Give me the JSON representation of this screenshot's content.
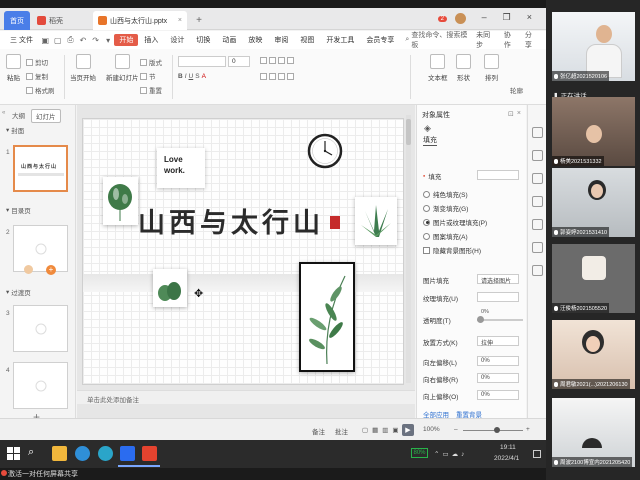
{
  "tabs": {
    "home": "首页",
    "store": "稻壳",
    "document": "山西与太行山.pptx",
    "add": "+"
  },
  "menu": {
    "file": "三 文件",
    "items": [
      "开始",
      "插入",
      "设计",
      "切换",
      "动画",
      "放映",
      "审阅",
      "视图",
      "开发工具",
      "会员专享"
    ],
    "search": "查找命令、搜索模板",
    "right": [
      "未同步",
      "协作",
      "分享"
    ]
  },
  "ribbon": {
    "paste": "粘贴",
    "cut": "剪切",
    "copy": "复制",
    "format_painter": "格式刷",
    "current_page": "当页开始",
    "new_slide": "新建幻灯片",
    "layout": "版式",
    "section": "节",
    "reset": "重置",
    "font_size": "0",
    "text_box": "文本框",
    "shape": "形状",
    "arrange": "排列",
    "outline": "轮廓"
  },
  "left_panel": {
    "tabs": [
      "大纲",
      "幻灯片"
    ],
    "sections": [
      "封面",
      "目录页",
      "过渡页"
    ],
    "slide_numbers": [
      "1",
      "2",
      "3",
      "4"
    ],
    "add": "+"
  },
  "slide": {
    "title": "山西与太行山",
    "love_line1": "Love",
    "love_line2": "work.",
    "notes": "单击此处添加备注"
  },
  "property_panel": {
    "title": "对象属性",
    "tab": "填充",
    "fill_header": "填充",
    "options": [
      "纯色填充(S)",
      "渐变填充(G)",
      "图片或纹理填充(P)",
      "图案填充(A)"
    ],
    "selected_option_index": 2,
    "hide_bg": "隐藏背景图形(H)",
    "image_fill": "图片填充",
    "image_fill_value": "请选择图片",
    "texture_fill": "纹理填充(U)",
    "transparency": "透明度(T)",
    "transparency_value": "0%",
    "transparency_fraction": 0,
    "tile_mode": "放置方式(K)",
    "tile_value": "拉伸",
    "offset_left": "向左偏移(L)",
    "offset_right": "向右偏移(R)",
    "offset_up": "向上偏移(O)",
    "offset_value": "0%",
    "apply_all": "全部应用",
    "reset_bg": "重置背景"
  },
  "statusbar": {
    "notes_toggle": "备注",
    "comment": "批注",
    "zoom": "100%",
    "zoom_fraction": 0.55
  },
  "taskbar": {
    "battery": "80%",
    "time": "19:11",
    "date": "2022/4/1"
  },
  "caption": "激活一对任何屏幕共享",
  "meeting": {
    "speaking": "正在讲话",
    "participants": [
      "张亿超2021520106",
      "杨美2021531332",
      "郭姿婷2021531410",
      "汪俊杨2021505520",
      "周君敏2021(...)2021206130",
      "周波2100博宣内2021205420"
    ]
  },
  "colors": {
    "accent": "#e45c48",
    "brand_blue": "#4a7ee8",
    "seal_red": "#c52b2b"
  }
}
